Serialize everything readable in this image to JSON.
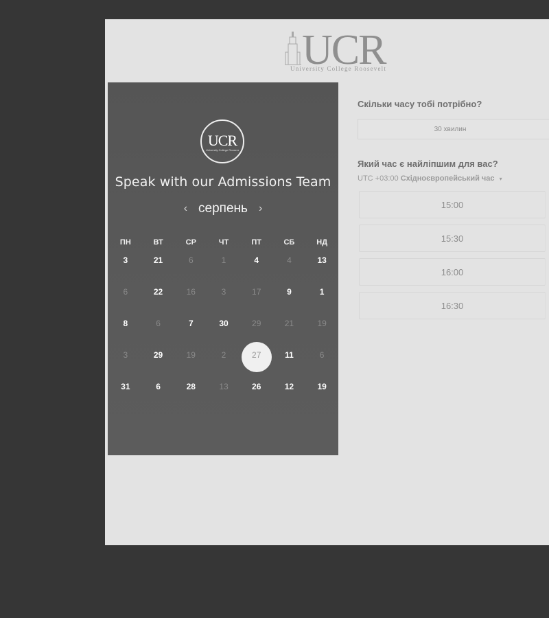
{
  "header": {
    "logo_text": "UCR",
    "logo_tagline": "University College Roosevelt"
  },
  "calendar": {
    "title": "Speak with our Admissions Team",
    "month": "серпень",
    "prev_icon": "chevron-left-icon",
    "next_icon": "chevron-right-icon",
    "weekdays": [
      "ПН",
      "ВТ",
      "СР",
      "ЧТ",
      "ПТ",
      "СБ",
      "НД"
    ],
    "rows": [
      [
        {
          "d": "3",
          "on": true
        },
        {
          "d": "21",
          "on": true
        },
        {
          "d": "6",
          "on": false
        },
        {
          "d": "1",
          "on": false
        },
        {
          "d": "4",
          "on": true
        },
        {
          "d": "4",
          "on": false
        },
        {
          "d": "13",
          "on": true
        }
      ],
      [
        {
          "d": "6",
          "on": false
        },
        {
          "d": "22",
          "on": true
        },
        {
          "d": "16",
          "on": false
        },
        {
          "d": "3",
          "on": false
        },
        {
          "d": "17",
          "on": false
        },
        {
          "d": "9",
          "on": true
        },
        {
          "d": "1",
          "on": true
        }
      ],
      [
        {
          "d": "8",
          "on": true
        },
        {
          "d": "6",
          "on": false
        },
        {
          "d": "7",
          "on": true
        },
        {
          "d": "30",
          "on": true
        },
        {
          "d": "29",
          "on": false
        },
        {
          "d": "21",
          "on": false
        },
        {
          "d": "19",
          "on": false
        }
      ],
      [
        {
          "d": "3",
          "on": false
        },
        {
          "d": "29",
          "on": true
        },
        {
          "d": "19",
          "on": false
        },
        {
          "d": "2",
          "on": false
        },
        {
          "d": "27",
          "on": false,
          "selected": true
        },
        {
          "d": "11",
          "on": true
        },
        {
          "d": "6",
          "on": false
        }
      ],
      [
        {
          "d": "31",
          "on": true
        },
        {
          "d": "6",
          "on": true
        },
        {
          "d": "28",
          "on": true
        },
        {
          "d": "13",
          "on": false
        },
        {
          "d": "26",
          "on": true
        },
        {
          "d": "12",
          "on": true
        },
        {
          "d": "19",
          "on": true
        }
      ]
    ]
  },
  "booking": {
    "duration_question": "Скільки часу тобі потрібно?",
    "duration_value": "30 хвилин",
    "time_question": "Який час є найліпшим для вас?",
    "timezone_offset": "UTC +03:00",
    "timezone_name": "Східноєвропейський час",
    "timezone_caret": "▾",
    "slots": [
      "15:00",
      "15:30",
      "16:00",
      "16:30"
    ]
  }
}
